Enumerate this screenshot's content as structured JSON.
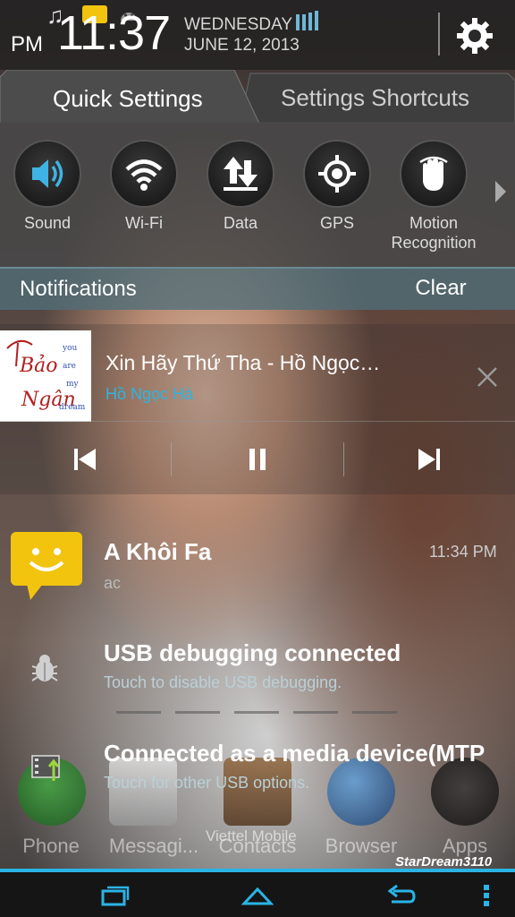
{
  "status_bar": {
    "ampm": "PM",
    "time": "11:37",
    "weekday": "WEDNESDAY",
    "date": "JUNE 12, 2013"
  },
  "tabs": [
    {
      "label": "Quick Settings",
      "active": true
    },
    {
      "label": "Settings Shortcuts",
      "active": false
    }
  ],
  "quick_settings": [
    {
      "label": "Sound",
      "icon": "speaker-icon",
      "active": true
    },
    {
      "label": "Wi-Fi",
      "icon": "wifi-icon",
      "active": false
    },
    {
      "label": "Data",
      "icon": "data-arrows-icon",
      "active": false
    },
    {
      "label": "GPS",
      "icon": "gps-icon",
      "active": false
    },
    {
      "label": "Motion\nRecognition",
      "icon": "motion-hand-icon",
      "active": false
    }
  ],
  "notifications_header": {
    "title": "Notifications",
    "clear_label": "Clear"
  },
  "music": {
    "title": "Xin Hãy Thứ Tha - Hồ Ngọc…",
    "artist": "Hồ Ngọc Hà",
    "album_art_text": [
      "Bảo",
      "Ngân",
      "you",
      "are",
      "my",
      "dream"
    ]
  },
  "notifications": [
    {
      "id": "sms",
      "title": "A Khôi Fa",
      "text": "ac",
      "time": "11:34 PM"
    },
    {
      "id": "usb",
      "title": "USB debugging connected",
      "text": "Touch to disable USB debugging."
    },
    {
      "id": "mtp",
      "title": "Connected as a media device(MTP",
      "text": "Touch for other USB options."
    }
  ],
  "dock": {
    "labels": [
      "Phone",
      "Messagi...",
      "Contacts",
      "Browser",
      "Apps"
    ],
    "carrier": "Viettel Mobile"
  },
  "watermark": "StarDream3110",
  "colors": {
    "accent": "#2ab4e6",
    "sms_yellow": "#f2c40e",
    "artist_blue": "#2cb5e0"
  }
}
